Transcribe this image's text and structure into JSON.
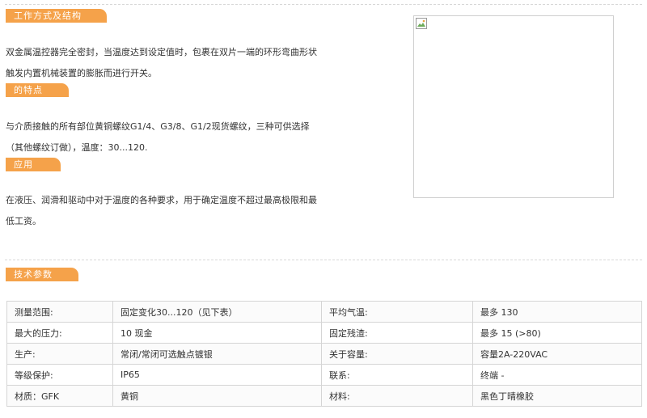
{
  "sections": {
    "working": {
      "title": "工作方式及结构",
      "line1": "双金属温控器完全密封，当温度达到设定值时，包裹在双片一端的环形弯曲形状",
      "line2": "触发内置机械装置的膨胀而进行开关。"
    },
    "features": {
      "title": "的特点",
      "line1": "与介质接触的所有部位黄铜螺纹G1/4、G3/8、G1/2现货螺纹，三种可供选择",
      "line2": "（其他螺纹订做），温度：30...120."
    },
    "application": {
      "title": "应用",
      "line1": "在液压、润滑和驱动中对于温度的各种要求，用于确定温度不超过最高极限和最",
      "line2": "低工资。"
    },
    "specs": {
      "title": "技术参数"
    }
  },
  "image": {
    "icon": "broken-image-icon"
  },
  "table": {
    "rows": [
      [
        "测量范围:",
        "固定变化30...120（见下表）",
        "平均气温:",
        "最多 130"
      ],
      [
        "最大的压力:",
        "10 现金",
        "固定残渣:",
        "最多 15 (>80)"
      ],
      [
        "生产:",
        "常闭/常闭可选触点镀银",
        "关于容量:",
        "容量2A-220VAC"
      ],
      [
        "等级保护:",
        "IP65",
        "联系:",
        "终端 -"
      ],
      [
        "材质：GFK",
        "黄铜",
        "材料:",
        "黑色丁晴橡胶"
      ]
    ]
  },
  "colors": {
    "tab": "#f5a24a",
    "border": "#d5d5d5"
  }
}
